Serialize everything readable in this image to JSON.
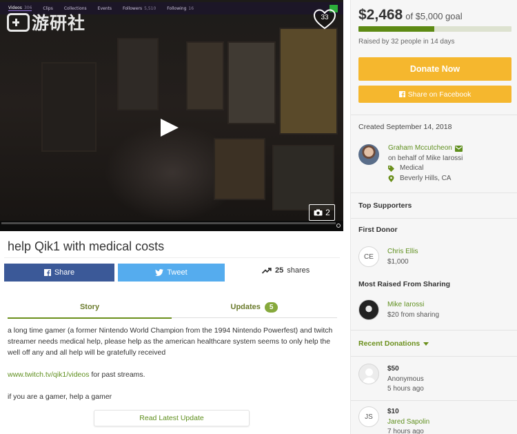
{
  "video": {
    "twitch_tabs": [
      {
        "label": "Videos",
        "count": "306"
      },
      {
        "label": "Clips",
        "count": ""
      },
      {
        "label": "Collections",
        "count": ""
      },
      {
        "label": "Events",
        "count": ""
      },
      {
        "label": "Followers",
        "count": "5,510"
      },
      {
        "label": "Following",
        "count": "16"
      }
    ],
    "watermark_text": "游研社",
    "heart_count": "33",
    "photo_count": "2",
    "icons": [
      "play-icon",
      "heart-icon",
      "camera-icon",
      "settings-icon"
    ]
  },
  "campaign": {
    "title": "help Qik1 with medical costs",
    "share_facebook_label": "Share",
    "share_twitter_label": "Tweet",
    "shares_count": "25",
    "shares_label": "shares",
    "tabs": {
      "story": "Story",
      "updates": "Updates",
      "updates_count": "5"
    },
    "story": {
      "paragraph1": "a long time gamer (a former Nintendo World Champion from the 1994 Nintendo Powerfest) and twitch streamer needs medical help, please help as the american healthcare system seems to only help the well off any and all help will be gratefully received",
      "link_text": "www.twitch.tv/qik1/videos",
      "link_suffix": " for past streams.",
      "paragraph3": "if you are a gamer, help a gamer"
    },
    "read_update_label": "Read Latest Update"
  },
  "sidebar": {
    "raised_amount": "$2,468",
    "goal_text": "of $5,000 goal",
    "progress_fraction": 0.4936,
    "raised_by": "Raised by 32 people in 14 days",
    "donate_label": "Donate Now",
    "facebook_label": "Share on Facebook",
    "created": "Created September 14, 2018",
    "organizer": {
      "name": "Graham Mccutcheon",
      "on_behalf": "on behalf of Mike Iarossi",
      "category": "Medical",
      "location": "Beverly Hills, CA"
    },
    "top_supporters_label": "Top Supporters",
    "first_donor_label": "First Donor",
    "first_donor": {
      "initials": "CE",
      "name": "Chris Ellis",
      "amount": "$1,000"
    },
    "most_raised_label": "Most Raised From Sharing",
    "most_raised": {
      "name": "Mike Iarossi",
      "amount": "$20 from sharing"
    },
    "recent_label": "Recent Donations",
    "recent": [
      {
        "amount": "$50",
        "name": "Anonymous",
        "time": "5 hours ago",
        "initials": ""
      },
      {
        "amount": "$10",
        "name": "Jared Sapolin",
        "time": "7 hours ago",
        "initials": "JS"
      }
    ],
    "colors": {
      "accent_green": "#5d8a14",
      "donate_yellow": "#f5b72e",
      "facebook_blue": "#3b5998",
      "twitter_blue": "#55acee"
    }
  }
}
